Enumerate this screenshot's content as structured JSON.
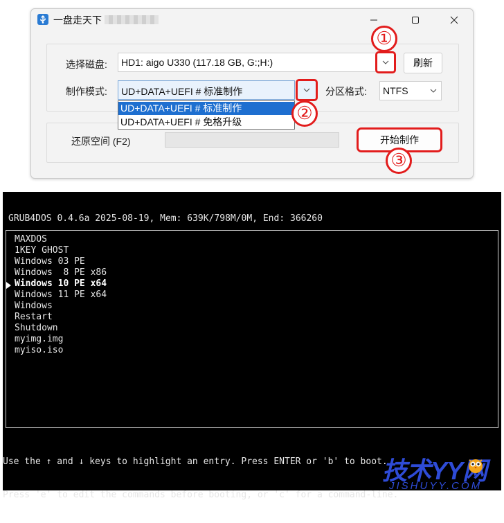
{
  "window": {
    "title": "一盘走天下",
    "controls": {
      "minimize": "minimize-icon",
      "maximize": "maximize-icon",
      "close": "close-icon"
    }
  },
  "form": {
    "disk_label": "选择磁盘:",
    "disk_value": "HD1: aigo U330 (117.18 GB, G:;H:)",
    "refresh_label": "刷新",
    "mode_label": "制作模式:",
    "mode_value": "UD+DATA+UEFI # 标准制作",
    "mode_options": [
      "UD+DATA+UEFI # 标准制作",
      "UD+DATA+UEFI # 免格升级"
    ],
    "partition_label": "分区格式:",
    "partition_value": "NTFS",
    "restore_label": "还原空间 (F2)",
    "start_label": "开始制作",
    "progress": 0
  },
  "markers": [
    "①",
    "②",
    "③"
  ],
  "colors": {
    "highlight": "#e21c1c",
    "selection": "#1e6fd0",
    "watermark": "#2e4bd6"
  },
  "grub": {
    "header": "GRUB4DOS 0.4.6a 2025-08-19, Mem: 639K/798M/0M, End: 366260",
    "menu": [
      "MAXDOS",
      "1KEY GHOST",
      "Windows 03 PE",
      "Windows  8 PE x86",
      "Windows 10 PE x64",
      "Windows 11 PE x64",
      "Windows",
      "Restart",
      "Shutdown",
      "myimg.img",
      "myiso.iso"
    ],
    "selected_index": 4,
    "help_line1": "Use the ↑ and ↓ keys to highlight an entry. Press ENTER or 'b' to boot.",
    "help_line2": "Press 'e' to edit the commands before booting, or 'c' for a command-line."
  },
  "watermark": {
    "main": "技术YY网",
    "sub": "JISHUYY.COM"
  }
}
